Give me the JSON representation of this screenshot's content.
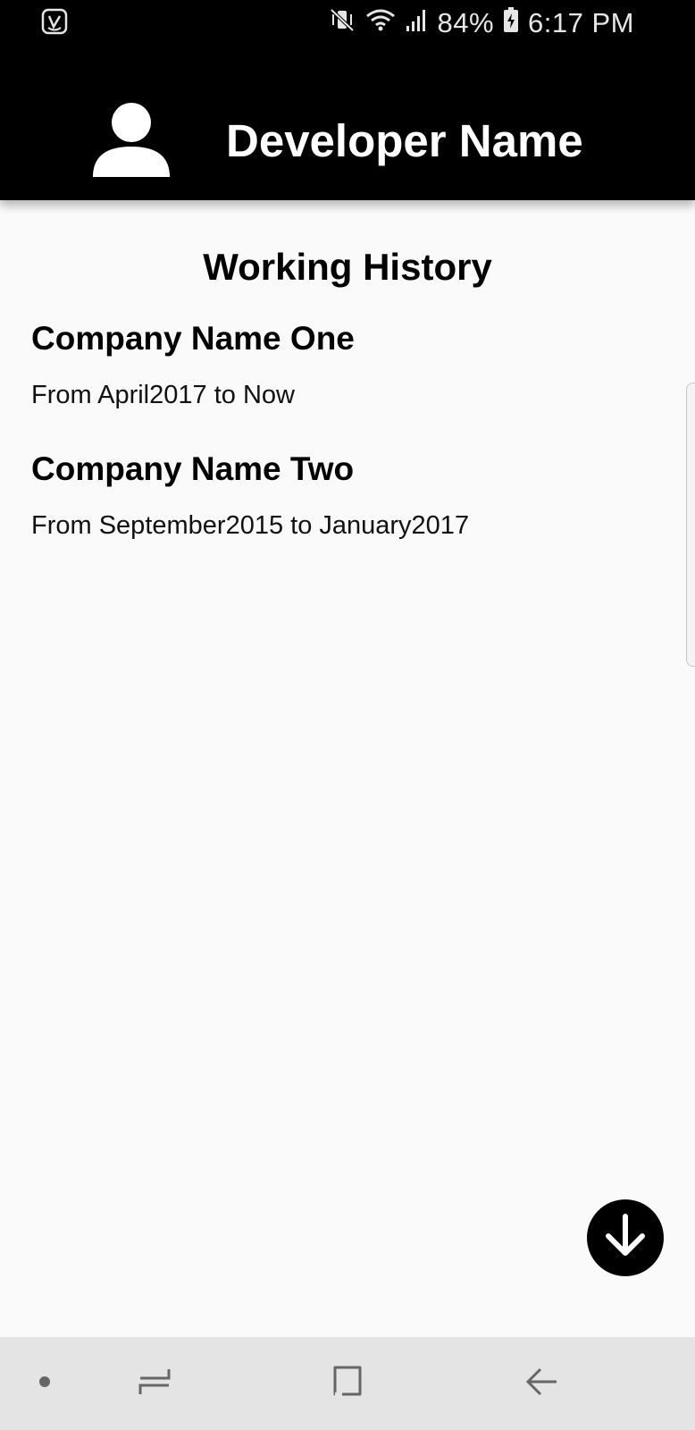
{
  "status_bar": {
    "app_icon": "saavn-app-icon",
    "icons": [
      "vibrate-mute-icon",
      "wifi-icon",
      "signal-icon",
      "battery-charging-icon"
    ],
    "battery": "84%",
    "time": "6:17 PM"
  },
  "header": {
    "avatar_icon": "person-icon",
    "developer_name": "Developer Name"
  },
  "main": {
    "section_title": "Working History",
    "jobs": [
      {
        "company": "Company Name One",
        "period": "From April2017 to Now"
      },
      {
        "company": "Company Name Two",
        "period": "From September2015 to January2017"
      }
    ]
  },
  "fab": {
    "icon": "arrow-down-icon"
  },
  "nav_bar": {
    "items": [
      "dot-icon",
      "recent-apps-icon",
      "home-icon",
      "back-icon"
    ]
  },
  "colors": {
    "header_bg": "#000000",
    "content_bg": "#fafafa",
    "nav_bg": "#e4e4e4",
    "fab_bg": "#000000"
  }
}
